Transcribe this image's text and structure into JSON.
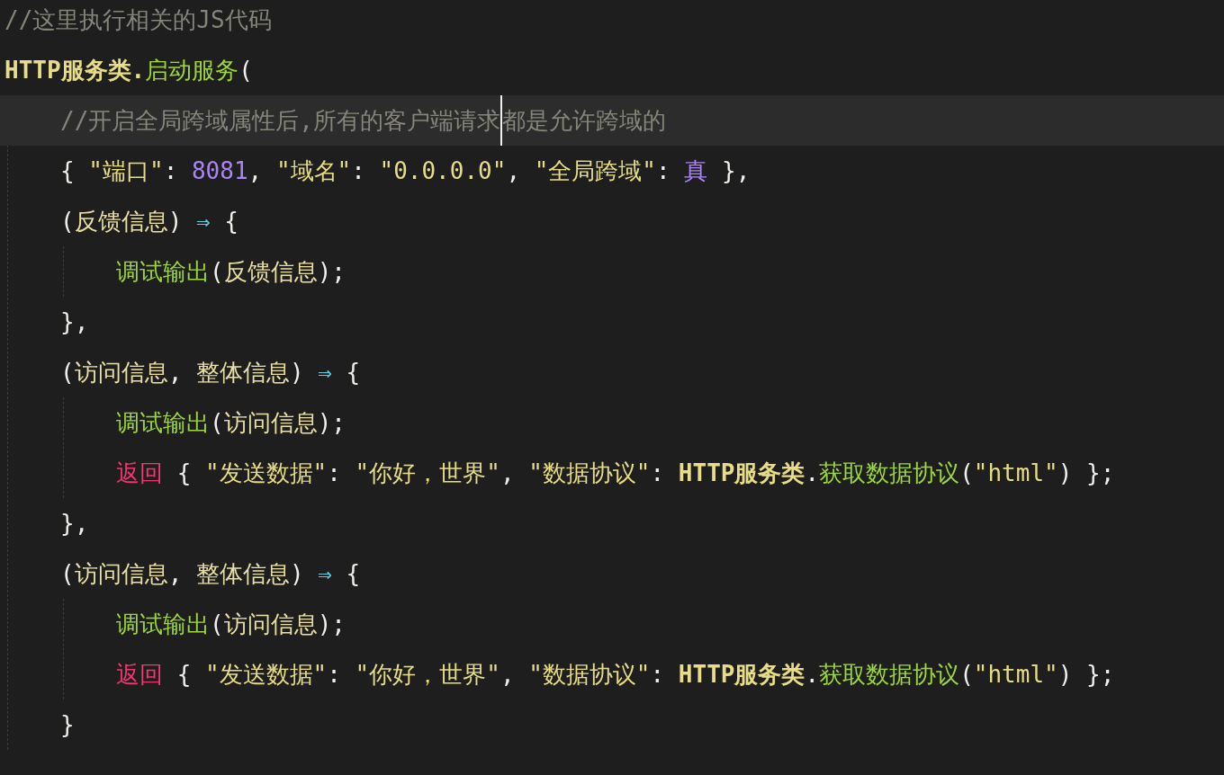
{
  "lines": [
    {
      "tokens": [
        {
          "kind": "comment",
          "text": "//这里执行相关的JS代码"
        }
      ]
    },
    {
      "tokens": [
        {
          "kind": "class",
          "text": "HTTP服务类."
        },
        {
          "kind": "func",
          "text": "启动服务"
        },
        {
          "kind": "plain",
          "text": "("
        }
      ],
      "children": [
        {
          "current": true,
          "tokens": [
            {
              "kind": "comment",
              "text": "//开启全局跨域属性后,所有的客户端请求"
            },
            {
              "kind": "comment",
              "text": "都是允许跨域的",
              "caret_before": true
            }
          ]
        },
        {
          "tokens": [
            {
              "kind": "plain",
              "text": "{ "
            },
            {
              "kind": "string",
              "text": "\"端口\""
            },
            {
              "kind": "plain",
              "text": ": "
            },
            {
              "kind": "number",
              "text": "8081"
            },
            {
              "kind": "plain",
              "text": ", "
            },
            {
              "kind": "string",
              "text": "\"域名\""
            },
            {
              "kind": "plain",
              "text": ": "
            },
            {
              "kind": "string",
              "text": "\"0.0.0.0\""
            },
            {
              "kind": "plain",
              "text": ", "
            },
            {
              "kind": "string",
              "text": "\"全局跨域\""
            },
            {
              "kind": "plain",
              "text": ": "
            },
            {
              "kind": "number",
              "text": "真"
            },
            {
              "kind": "plain",
              "text": " },"
            }
          ]
        },
        {
          "tokens": [
            {
              "kind": "plain",
              "text": "("
            },
            {
              "kind": "param",
              "text": "反馈信息"
            },
            {
              "kind": "plain",
              "text": ") "
            },
            {
              "kind": "arrow",
              "text": "⇒"
            },
            {
              "kind": "plain",
              "text": " {"
            }
          ],
          "children": [
            {
              "tokens": [
                {
                  "kind": "func",
                  "text": "调试输出"
                },
                {
                  "kind": "plain",
                  "text": "("
                },
                {
                  "kind": "param",
                  "text": "反馈信息"
                },
                {
                  "kind": "plain",
                  "text": ");"
                }
              ]
            }
          ]
        },
        {
          "tokens": [
            {
              "kind": "plain",
              "text": "},"
            }
          ]
        },
        {
          "tokens": [
            {
              "kind": "plain",
              "text": "("
            },
            {
              "kind": "param",
              "text": "访问信息"
            },
            {
              "kind": "plain",
              "text": ", "
            },
            {
              "kind": "param",
              "text": "整体信息"
            },
            {
              "kind": "plain",
              "text": ") "
            },
            {
              "kind": "arrow",
              "text": "⇒"
            },
            {
              "kind": "plain",
              "text": " {"
            }
          ],
          "children": [
            {
              "tokens": [
                {
                  "kind": "func",
                  "text": "调试输出"
                },
                {
                  "kind": "plain",
                  "text": "("
                },
                {
                  "kind": "param",
                  "text": "访问信息"
                },
                {
                  "kind": "plain",
                  "text": ");"
                }
              ]
            },
            {
              "tokens": [
                {
                  "kind": "keyword",
                  "text": "返回"
                },
                {
                  "kind": "plain",
                  "text": " { "
                },
                {
                  "kind": "string",
                  "text": "\"发送数据\""
                },
                {
                  "kind": "plain",
                  "text": ": "
                },
                {
                  "kind": "string",
                  "text": "\"你好，世界\""
                },
                {
                  "kind": "plain",
                  "text": ", "
                },
                {
                  "kind": "string",
                  "text": "\"数据协议\""
                },
                {
                  "kind": "plain",
                  "text": ": "
                },
                {
                  "kind": "class",
                  "text": "HTTP服务类"
                },
                {
                  "kind": "plain",
                  "text": "."
                },
                {
                  "kind": "func",
                  "text": "获取数据协议"
                },
                {
                  "kind": "plain",
                  "text": "("
                },
                {
                  "kind": "string",
                  "text": "\"html\""
                },
                {
                  "kind": "plain",
                  "text": ") };"
                }
              ]
            }
          ]
        },
        {
          "tokens": [
            {
              "kind": "plain",
              "text": "},"
            }
          ]
        },
        {
          "tokens": [
            {
              "kind": "plain",
              "text": "("
            },
            {
              "kind": "param",
              "text": "访问信息"
            },
            {
              "kind": "plain",
              "text": ", "
            },
            {
              "kind": "param",
              "text": "整体信息"
            },
            {
              "kind": "plain",
              "text": ") "
            },
            {
              "kind": "arrow",
              "text": "⇒"
            },
            {
              "kind": "plain",
              "text": " {"
            }
          ],
          "children": [
            {
              "tokens": [
                {
                  "kind": "func",
                  "text": "调试输出"
                },
                {
                  "kind": "plain",
                  "text": "("
                },
                {
                  "kind": "param",
                  "text": "访问信息"
                },
                {
                  "kind": "plain",
                  "text": ");"
                }
              ]
            },
            {
              "tokens": [
                {
                  "kind": "keyword",
                  "text": "返回"
                },
                {
                  "kind": "plain",
                  "text": " { "
                },
                {
                  "kind": "string",
                  "text": "\"发送数据\""
                },
                {
                  "kind": "plain",
                  "text": ": "
                },
                {
                  "kind": "string",
                  "text": "\"你好，世界\""
                },
                {
                  "kind": "plain",
                  "text": ", "
                },
                {
                  "kind": "string",
                  "text": "\"数据协议\""
                },
                {
                  "kind": "plain",
                  "text": ": "
                },
                {
                  "kind": "class",
                  "text": "HTTP服务类"
                },
                {
                  "kind": "plain",
                  "text": "."
                },
                {
                  "kind": "func",
                  "text": "获取数据协议"
                },
                {
                  "kind": "plain",
                  "text": "("
                },
                {
                  "kind": "string",
                  "text": "\"html\""
                },
                {
                  "kind": "plain",
                  "text": ") };"
                }
              ]
            }
          ]
        },
        {
          "tokens": [
            {
              "kind": "plain",
              "text": "}"
            }
          ]
        }
      ]
    }
  ]
}
